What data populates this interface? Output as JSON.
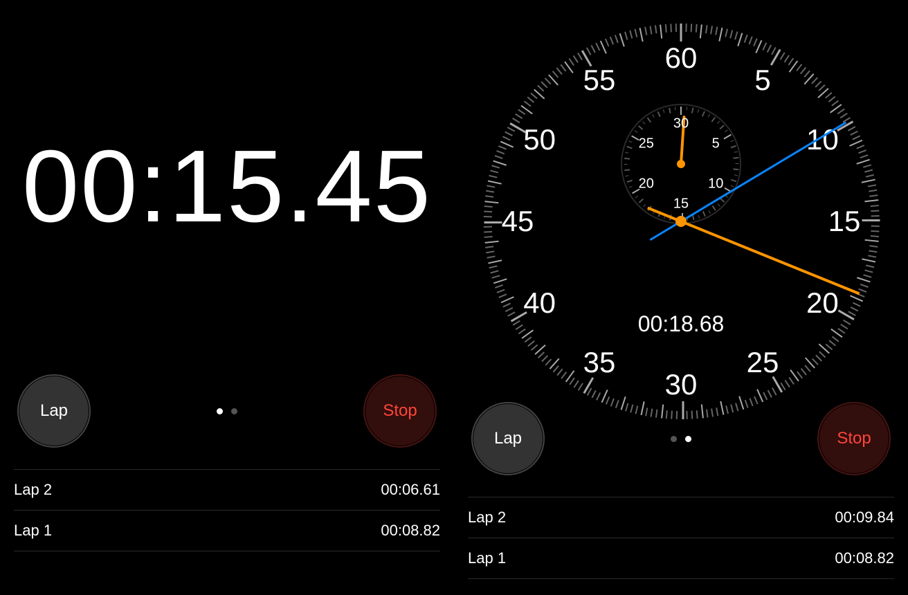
{
  "digital": {
    "elapsed": "00:15.45",
    "lap_button": "Lap",
    "stop_button": "Stop",
    "page_index": 0,
    "laps": [
      {
        "label": "Lap 2",
        "time": "00:06.61"
      },
      {
        "label": "Lap 1",
        "time": "00:08.82"
      }
    ]
  },
  "analog": {
    "elapsed": "00:18.68",
    "lap_button": "Lap",
    "stop_button": "Stop",
    "page_index": 1,
    "dial_numbers": [
      "60",
      "5",
      "10",
      "15",
      "20",
      "25",
      "30",
      "35",
      "40",
      "45",
      "50",
      "55"
    ],
    "subdial_numbers": [
      "30",
      "5",
      "10",
      "15",
      "20",
      "25"
    ],
    "seconds_hand_value": 18.68,
    "lap_hand_value": 9.84,
    "minute_hand_value": 0.31,
    "laps": [
      {
        "label": "Lap 2",
        "time": "00:09.84"
      },
      {
        "label": "Lap 1",
        "time": "00:08.82"
      }
    ]
  },
  "colors": {
    "orange": "#ff9500",
    "blue": "#0a84ff",
    "red": "#ff453a",
    "gray_button": "#333333"
  }
}
